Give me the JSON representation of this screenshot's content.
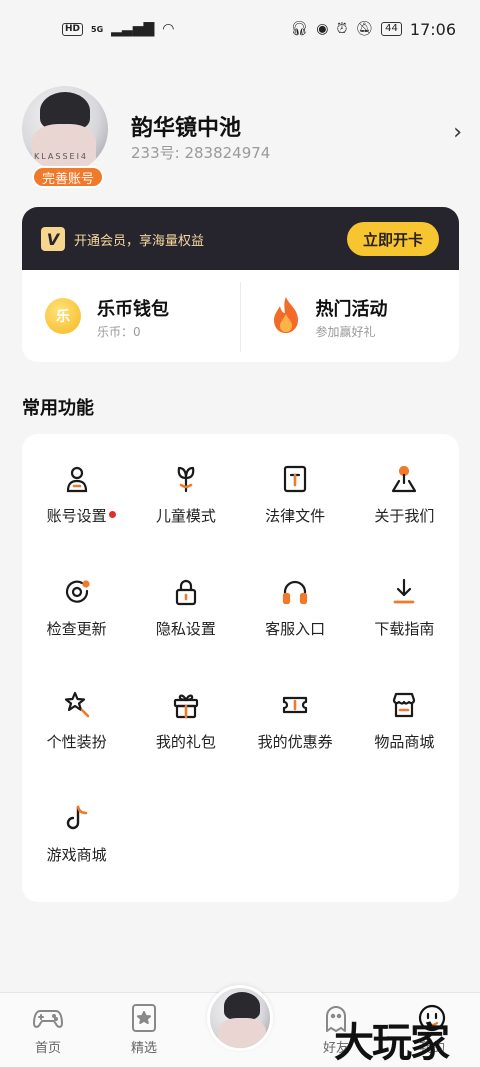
{
  "status_bar": {
    "hd": "HD",
    "network": "5G",
    "battery": "44",
    "time": "17:06"
  },
  "profile": {
    "avatar_text": "KLASSEI4",
    "badge": "完善账号",
    "name": "韵华镜中池",
    "id": "233号: 283824974"
  },
  "vip": {
    "logo": "V",
    "text": "开通会员，享海量权益",
    "button": "立即开卡"
  },
  "wallet": {
    "coin_title": "乐币钱包",
    "coin_sub": "乐币：0",
    "coin_glyph": "乐",
    "event_title": "热门活动",
    "event_sub": "参加赢好礼"
  },
  "functions": {
    "title": "常用功能",
    "items": [
      {
        "label": "账号设置",
        "icon": "user-icon",
        "dot": true
      },
      {
        "label": "儿童模式",
        "icon": "sprout-icon"
      },
      {
        "label": "法律文件",
        "icon": "document-icon"
      },
      {
        "label": "关于我们",
        "icon": "location-pin-icon"
      },
      {
        "label": "检查更新",
        "icon": "update-icon"
      },
      {
        "label": "隐私设置",
        "icon": "lock-icon"
      },
      {
        "label": "客服入口",
        "icon": "headset-icon"
      },
      {
        "label": "下载指南",
        "icon": "download-icon"
      },
      {
        "label": "个性装扮",
        "icon": "star-wand-icon"
      },
      {
        "label": "我的礼包",
        "icon": "gift-icon"
      },
      {
        "label": "我的优惠券",
        "icon": "coupon-icon"
      },
      {
        "label": "物品商城",
        "icon": "store-icon"
      },
      {
        "label": "游戏商城",
        "icon": "music-note-icon"
      }
    ]
  },
  "nav": {
    "home": "首页",
    "featured": "精选",
    "friends": "好友",
    "mine": "我的"
  },
  "watermark": "大玩家",
  "colors": {
    "accent": "#f07a2a",
    "vip_bg": "#26242c",
    "vip_button": "#f7c530",
    "red_dot": "#e82c2c"
  }
}
